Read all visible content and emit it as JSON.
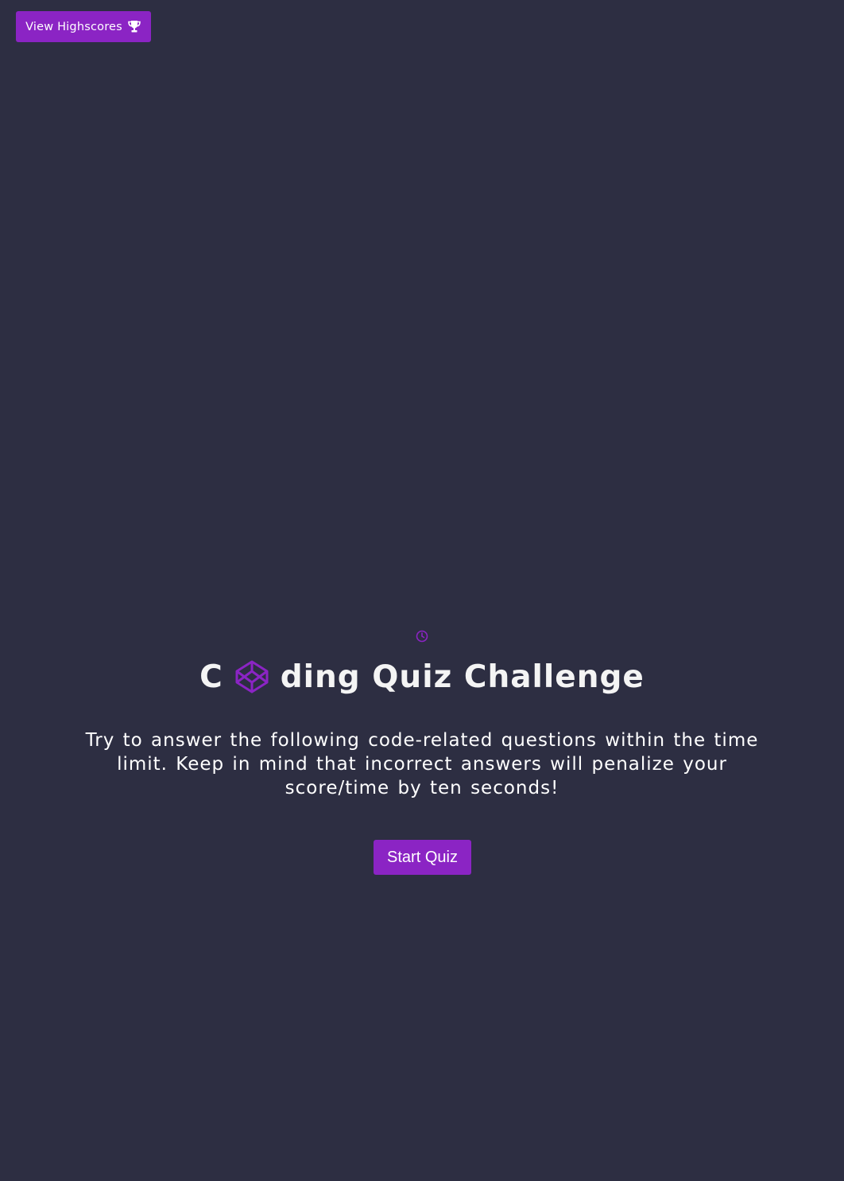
{
  "header": {
    "highscores_label": "View Highscores",
    "highscores_icon": "trophy-icon"
  },
  "timer": {
    "icon": "clock-icon"
  },
  "main": {
    "title_prefix": "C",
    "title_logo_icon": "codepen-cube-icon",
    "title_suffix": "ding Quiz Challenge",
    "intro": "Try to answer the following code-related questions within the time limit. Keep in mind that incorrect answers will penalize your score/time by ten seconds!",
    "start_label": "Start Quiz"
  },
  "colors": {
    "background": "#2d2e42",
    "accent": "#8b24c4",
    "text": "#ffffff"
  }
}
